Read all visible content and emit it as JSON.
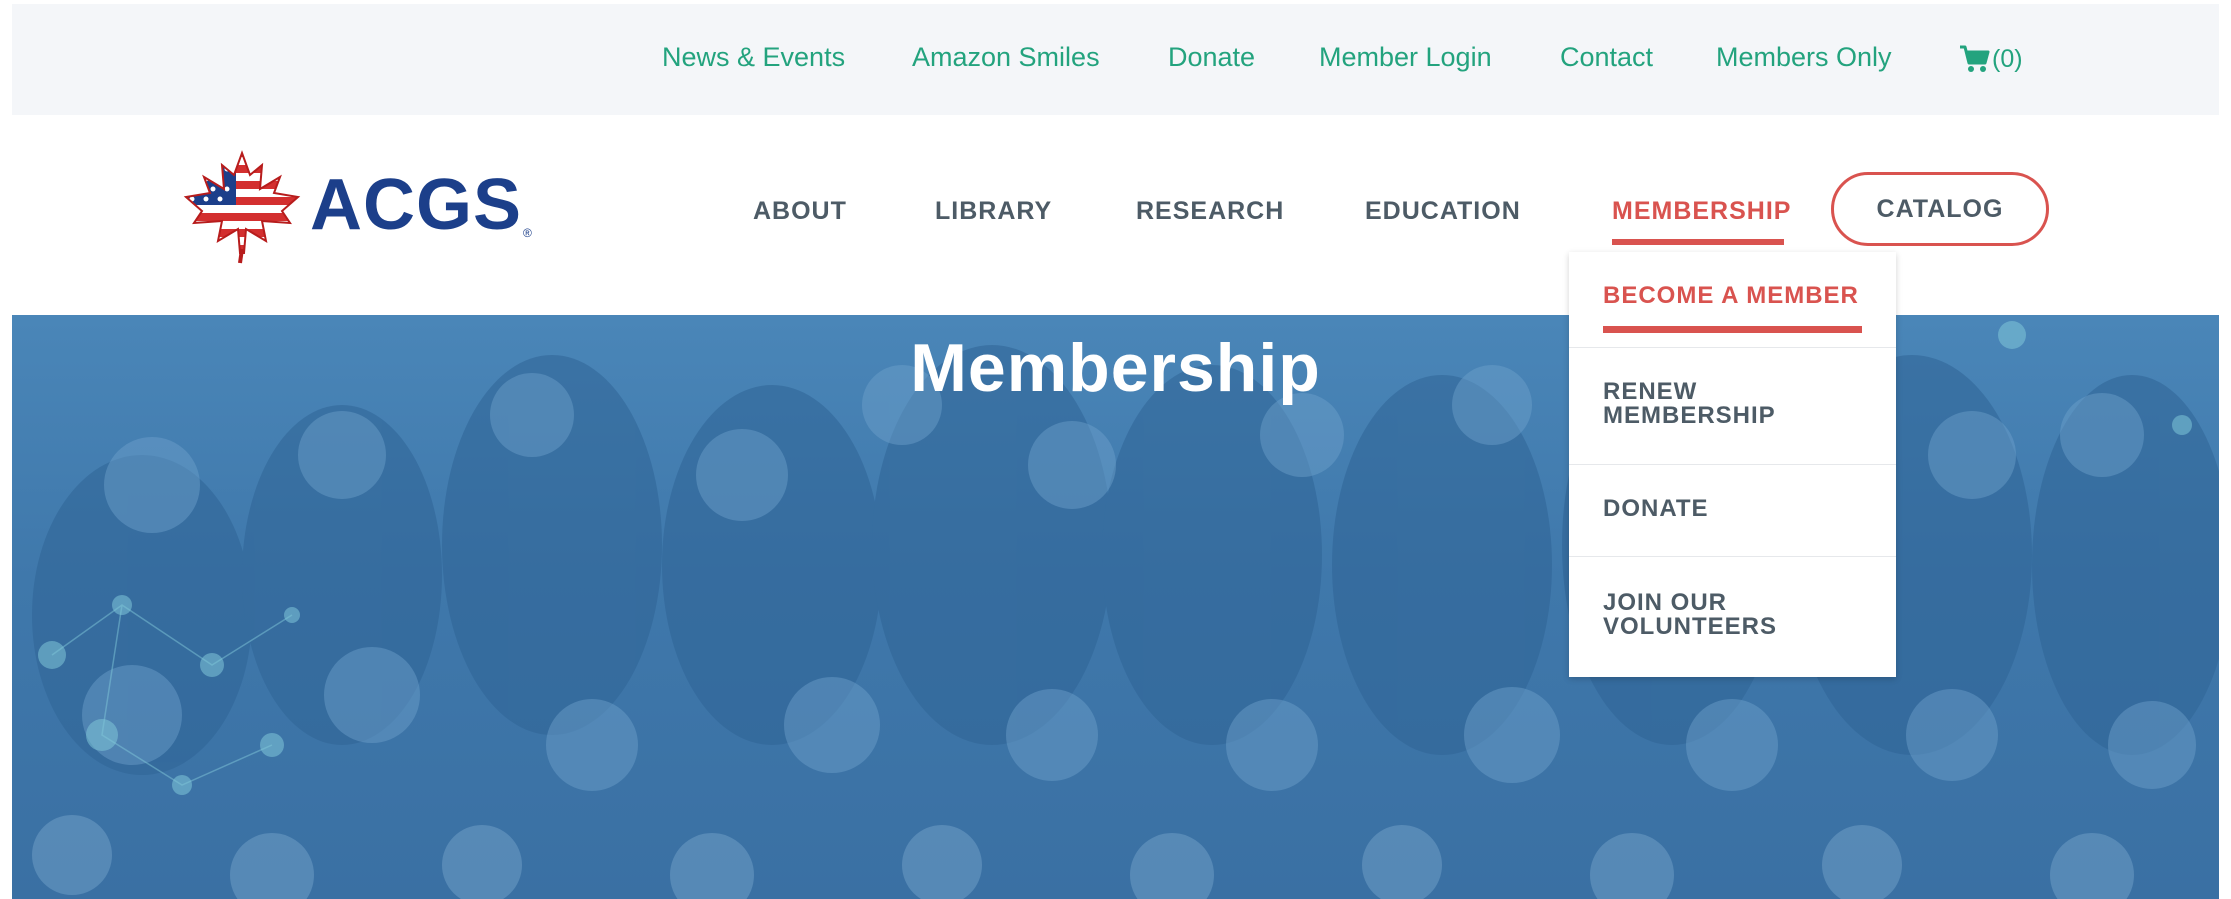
{
  "utility_nav": {
    "items": [
      {
        "label": "News & Events"
      },
      {
        "label": "Amazon Smiles"
      },
      {
        "label": "Donate"
      },
      {
        "label": "Member Login"
      },
      {
        "label": "Contact"
      },
      {
        "label": "Members Only"
      }
    ],
    "cart": {
      "icon": "shopping-cart-icon",
      "count": "(0)"
    }
  },
  "logo": {
    "text": "ACGS",
    "mark": "®",
    "icon": "maple-leaf-flag-icon"
  },
  "main_nav": {
    "items": [
      {
        "label": "ABOUT"
      },
      {
        "label": "LIBRARY"
      },
      {
        "label": "RESEARCH"
      },
      {
        "label": "EDUCATION"
      },
      {
        "label": "MEMBERSHIP",
        "active": true
      }
    ],
    "catalog_label": "CATALOG"
  },
  "hero": {
    "title": "Membership"
  },
  "membership_dropdown": {
    "items": [
      {
        "label": "BECOME A MEMBER",
        "active": true
      },
      {
        "label": "RENEW\nMEMBERSHIP"
      },
      {
        "label": "DONATE"
      },
      {
        "label": "JOIN OUR\nVOLUNTEERS"
      }
    ]
  },
  "colors": {
    "utility_link": "#23a37e",
    "accent_red": "#d9534f",
    "nav_text": "#4d5b66",
    "logo_blue": "#1c3f8a",
    "hero_overlay": "#3f78ab"
  }
}
